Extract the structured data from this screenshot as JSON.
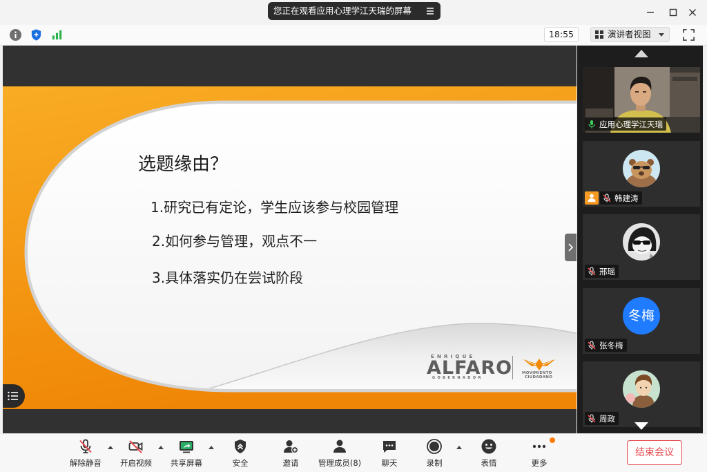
{
  "window": {
    "banner_text": "您正在观看应用心理学江天瑞的屏幕",
    "banner_menu_icon": "menu-icon",
    "controls": [
      "minimize-icon",
      "maximize-icon",
      "close-icon"
    ]
  },
  "infobar": {
    "icons": [
      "info-icon",
      "security-shield-icon",
      "network-signal-icon"
    ],
    "time": "18:55",
    "view_mode": "演讲者视图",
    "view_icon": "grid-icon",
    "fullscreen_icon": "fullscreen-icon"
  },
  "shared_screen": {
    "slide": {
      "title": "选题缘由？",
      "points": [
        "1.研究已有定论，学生应该参与校园管理",
        "2.如何参与管理，观点不一",
        "3.具体落实仍在尝试阶段"
      ],
      "logo": {
        "top": "ENRIQUE",
        "name": "ALFARO",
        "sub": "GOBERNADOR",
        "party_line1": "MOVIMIENTO",
        "party_line2": "CIUDADANO"
      }
    },
    "list_button_icon": "list-icon",
    "collapse_icon": "chevron-right-icon"
  },
  "participants_panel": {
    "scroll_up_icon": "caret-up-icon",
    "scroll_down_icon": "caret-down-icon",
    "participants": [
      {
        "name": "应用心理学江天瑞",
        "mic": "on",
        "view": "video"
      },
      {
        "name": "韩建涛",
        "mic": "muted",
        "view": "avatar",
        "badge_icon": "host-person-icon"
      },
      {
        "name": "邢瑶",
        "mic": "muted",
        "view": "avatar"
      },
      {
        "name": "张冬梅",
        "mic": "muted",
        "view": "initials",
        "initials": "冬梅"
      },
      {
        "name": "周政",
        "mic": "muted",
        "view": "avatar"
      }
    ]
  },
  "toolbar": {
    "items": [
      {
        "label": "解除静音",
        "icon": "mic-muted-icon",
        "has_menu": true
      },
      {
        "label": "开启视频",
        "icon": "camera-off-icon",
        "has_menu": true
      },
      {
        "label": "共享屏幕",
        "icon": "share-screen-icon",
        "has_menu": true
      },
      {
        "label": "安全",
        "icon": "security-icon",
        "has_menu": false
      },
      {
        "label": "邀请",
        "icon": "invite-icon",
        "has_menu": false
      },
      {
        "label": "管理成员(8)",
        "icon": "members-icon",
        "has_menu": false
      },
      {
        "label": "聊天",
        "icon": "chat-icon",
        "has_menu": false
      },
      {
        "label": "录制",
        "icon": "record-icon",
        "has_menu": true
      },
      {
        "label": "表情",
        "icon": "emoji-icon",
        "has_menu": false
      },
      {
        "label": "更多",
        "icon": "more-icon",
        "has_menu": false,
        "notification": true
      }
    ],
    "end_meeting_label": "结束会议"
  },
  "colors": {
    "share_green": "#2aae67",
    "danger_red": "#e5484d",
    "avatar_blue": "#1f7bff",
    "badge_orange": "#f59a23",
    "notify_orange": "#ff7a00",
    "slide_orange": "#f7a11a",
    "mic_on_green": "#3ecf5a"
  }
}
